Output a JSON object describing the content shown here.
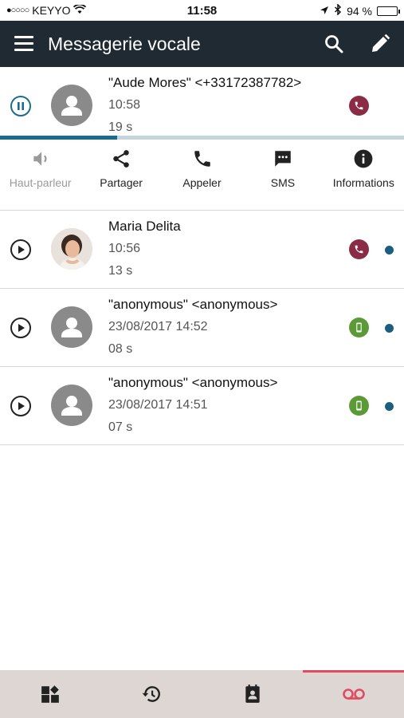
{
  "status_bar": {
    "signal": "●○○○○",
    "carrier": "KEYYO",
    "time": "11:58",
    "battery": "94 %",
    "battery_level": 0.94
  },
  "app_bar": {
    "title": "Messagerie vocale",
    "icons": [
      "menu-icon",
      "search-icon",
      "edit-icon"
    ]
  },
  "voicemails": [
    {
      "name": "\"Aude Mores\" <+33172387782>",
      "time": "10:58",
      "duration": "19 s",
      "state": "playing",
      "avatar": "default",
      "type": "phone",
      "unread": false,
      "progress": 0.29
    },
    {
      "name": "Maria Delita",
      "time": "10:56",
      "duration": "13 s",
      "state": "paused",
      "avatar": "photo",
      "type": "phone",
      "unread": true
    },
    {
      "name": "\"anonymous\" <anonymous>",
      "time": "23/08/2017 14:52",
      "duration": "08 s",
      "state": "paused",
      "avatar": "default",
      "type": "mobile",
      "unread": true
    },
    {
      "name": "\"anonymous\" <anonymous>",
      "time": "23/08/2017 14:51",
      "duration": "07 s",
      "state": "paused",
      "avatar": "default",
      "type": "mobile",
      "unread": true
    }
  ],
  "actions": [
    {
      "label": "Haut-parleur",
      "icon": "speaker-icon",
      "enabled": false
    },
    {
      "label": "Partager",
      "icon": "share-icon",
      "enabled": true
    },
    {
      "label": "Appeler",
      "icon": "phone-icon",
      "enabled": true
    },
    {
      "label": "SMS",
      "icon": "sms-icon",
      "enabled": true
    },
    {
      "label": "Informations",
      "icon": "info-icon",
      "enabled": true
    }
  ],
  "bottom_nav": {
    "tabs": [
      {
        "icon": "dashboard-icon",
        "active": false
      },
      {
        "icon": "history-icon",
        "active": false
      },
      {
        "icon": "contacts-icon",
        "active": false
      },
      {
        "icon": "voicemail-icon",
        "active": true
      }
    ]
  },
  "colors": {
    "app_bar": "#1f2a33",
    "accent": "#1b6c8d",
    "phone_badge": "#8b2c47",
    "mobile_badge": "#5c9a38",
    "nav_active": "#e24a5f",
    "nav_bg": "#ddd6d3"
  }
}
